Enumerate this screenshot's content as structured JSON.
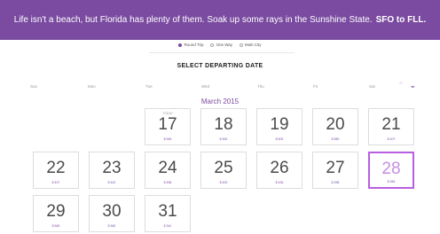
{
  "banner": {
    "message": "Life isn't a beach, but Florida has plenty of them. Soak up some rays in the Sunshine State.",
    "route": "SFO to FLL."
  },
  "trip_options": [
    {
      "label": "Round Trip",
      "selected": true
    },
    {
      "label": "One Way",
      "selected": false
    },
    {
      "label": "Multi City",
      "selected": false
    }
  ],
  "calendar": {
    "title": "SELECT DEPARTING DATE",
    "month": "March 2015",
    "weekdays": [
      "Sun",
      "Mon",
      "Tue",
      "Wed",
      "Thu",
      "Fri",
      "Sat"
    ],
    "today_label": "TODAY",
    "days": [
      {
        "day": "17",
        "price": "$ 545",
        "today": true
      },
      {
        "day": "18",
        "price": "$ 462"
      },
      {
        "day": "19",
        "price": "$ 602"
      },
      {
        "day": "20",
        "price": "$ 580"
      },
      {
        "day": "21",
        "price": "$ 407"
      },
      {
        "day": "22",
        "price": "$ 407"
      },
      {
        "day": "23",
        "price": "$ 442"
      },
      {
        "day": "24",
        "price": "$ 456"
      },
      {
        "day": "25",
        "price": "$ 400"
      },
      {
        "day": "26",
        "price": "$ 426"
      },
      {
        "day": "27",
        "price": "$ 398"
      },
      {
        "day": "28",
        "price": "$ 384",
        "selected": true
      },
      {
        "day": "29",
        "price": "$ 563"
      },
      {
        "day": "30",
        "price": "$ 362"
      },
      {
        "day": "31",
        "price": "$ 341"
      }
    ]
  },
  "nav": {
    "prev_icon": "chevron-up-icon",
    "next_icon": "chevron-down-icon"
  },
  "colors": {
    "accent": "#7a4ba0",
    "selected_border": "#b95ee0"
  }
}
